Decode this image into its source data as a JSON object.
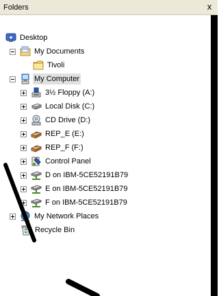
{
  "panel": {
    "title": "Folders",
    "close_label": "x"
  },
  "tree": [
    {
      "label": "Desktop",
      "icon": "desktop-icon",
      "level": 0,
      "expander": "none"
    },
    {
      "label": "My Documents",
      "icon": "my-documents-icon",
      "level": 1,
      "expander": "minus"
    },
    {
      "label": "Tivoli",
      "icon": "folder-icon",
      "level": 2,
      "expander": "none"
    },
    {
      "label": "My Computer",
      "icon": "my-computer-icon",
      "level": 1,
      "expander": "minus",
      "selected": true
    },
    {
      "label": "3½ Floppy (A:)",
      "icon": "floppy-drive-icon",
      "level": 2,
      "expander": "plus"
    },
    {
      "label": "Local Disk (C:)",
      "icon": "hard-disk-icon",
      "level": 2,
      "expander": "plus"
    },
    {
      "label": "CD Drive (D:)",
      "icon": "cd-drive-icon",
      "level": 2,
      "expander": "plus"
    },
    {
      "label": "REP_E (E:)",
      "icon": "removable-drive-icon",
      "level": 2,
      "expander": "plus"
    },
    {
      "label": "REP_F (F:)",
      "icon": "removable-drive-icon",
      "level": 2,
      "expander": "plus"
    },
    {
      "label": "Control Panel",
      "icon": "control-panel-icon",
      "level": 2,
      "expander": "plus"
    },
    {
      "label": "D on IBM-5CE52191B79",
      "icon": "network-drive-icon",
      "level": 2,
      "expander": "plus"
    },
    {
      "label": "E on IBM-5CE52191B79",
      "icon": "network-drive-icon",
      "level": 2,
      "expander": "plus"
    },
    {
      "label": "F on IBM-5CE52191B79",
      "icon": "network-drive-icon",
      "level": 2,
      "expander": "plus"
    },
    {
      "label": "My Network Places",
      "icon": "network-places-icon",
      "level": 1,
      "expander": "plus"
    },
    {
      "label": "Recycle Bin",
      "icon": "recycle-bin-icon",
      "level": 1,
      "expander": "none"
    }
  ]
}
